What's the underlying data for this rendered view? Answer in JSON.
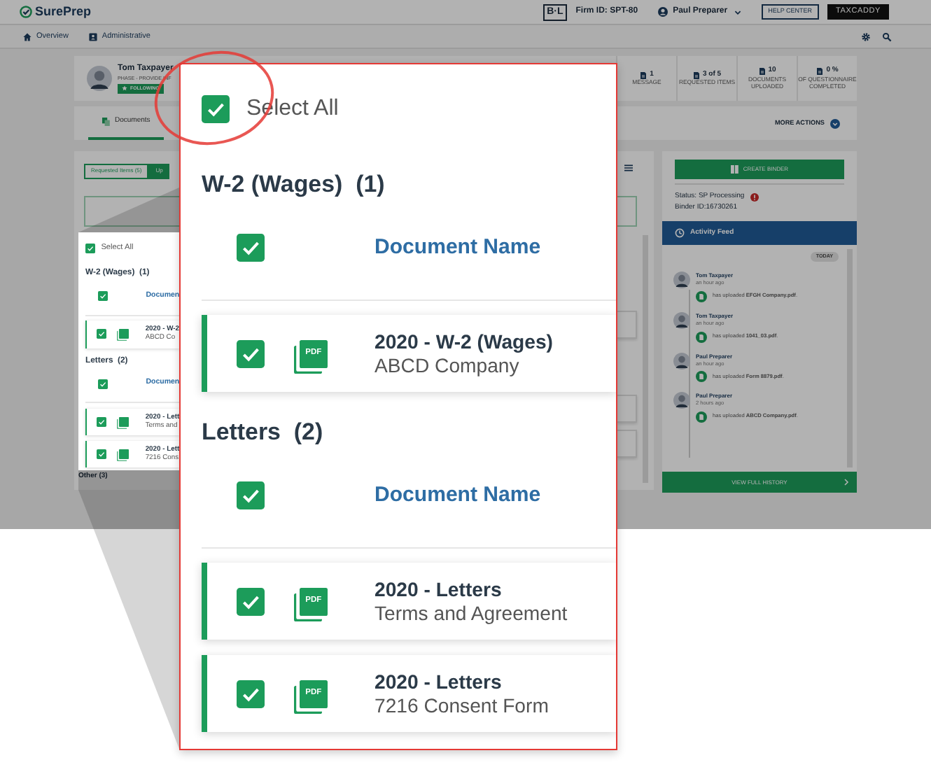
{
  "header": {
    "logo": "SurePrep",
    "firm_badge": "B·L",
    "firm_id": "Firm ID: SPT-80",
    "user": "Paul Preparer",
    "help": "HELP CENTER",
    "taxcaddy": "TAXCADDY"
  },
  "nav": [
    {
      "label": "Overview",
      "kind": "home"
    },
    {
      "label": "Administrative",
      "kind": "admin"
    }
  ],
  "client": {
    "name": "Tom Taxpayer",
    "phase": "PHASE - PROVIDE INF",
    "following": "FOLLOWING"
  },
  "stats": [
    {
      "value": "1",
      "label": "MESSAGE"
    },
    {
      "value": "3 of 5",
      "label": "REQUESTED ITEMS"
    },
    {
      "value": "10",
      "label": "DOCUMENTS UPLOADED"
    },
    {
      "value": "0 %",
      "label": "OF QUESTIONNAIRE COMPLETED"
    }
  ],
  "tabs": [
    {
      "label": "Documents",
      "selected": true
    }
  ],
  "more_actions": "MORE ACTIONS",
  "filters": [
    {
      "label": "Requested Items (5)",
      "selected": false
    },
    {
      "label": "Up",
      "selected": true
    }
  ],
  "other_group": "Other (3)",
  "binder": {
    "button": "CREATE BINDER",
    "status": "Status: SP Processing",
    "binder_id": "Binder ID:16730261"
  },
  "activity": {
    "title": "Activity Feed",
    "day": "TODAY",
    "footer": "VIEW FULL HISTORY",
    "entries": [
      {
        "name": "Tom Taxpayer",
        "time": "an hour ago",
        "text": "has uploaded **EFGH Company.pdf**."
      },
      {
        "name": "Tom Taxpayer",
        "time": "an hour ago",
        "text": "has uploaded **1041_03.pdf**."
      },
      {
        "name": "Paul Preparer",
        "time": "an hour ago",
        "text": "has uploaded **Form 8879.pdf**."
      },
      {
        "name": "Paul Preparer",
        "time": "2 hours ago",
        "text": "has uploaded **ABCD Company.pdf**."
      }
    ]
  },
  "mini_list": {
    "select_all": {
      "label": "Select All",
      "checked": true
    },
    "groups": [
      {
        "title": "W-2 (Wages)",
        "count": "(1)",
        "header_checked": true,
        "column": "Documen",
        "docs": [
          {
            "title": "2020 - W-2",
            "subtitle": "ABCD Co",
            "checked": true
          }
        ]
      },
      {
        "title": "Letters",
        "count": "(2)",
        "header_checked": true,
        "column": "Documen",
        "docs": [
          {
            "title": "2020 - Lett",
            "subtitle": "Terms and",
            "checked": true
          },
          {
            "title": "2020 - Lett",
            "subtitle": "7216 Cons",
            "checked": true
          }
        ]
      }
    ]
  },
  "callout": {
    "select_all": {
      "label": "Select All",
      "checked": true
    },
    "groups": [
      {
        "title": "W-2 (Wages)",
        "count": "(1)",
        "header_checked": true,
        "column": "Document Name",
        "docs": [
          {
            "title": "2020 - W-2 (Wages)",
            "subtitle": "ABCD Company",
            "file_type": "PDF",
            "checked": true
          }
        ]
      },
      {
        "title": "Letters",
        "count": "(2)",
        "header_checked": true,
        "column": "Document Name",
        "docs": [
          {
            "title": "2020 - Letters",
            "subtitle": "Terms and Agreement",
            "file_type": "PDF",
            "checked": true
          },
          {
            "title": "2020 - Letters",
            "subtitle": "7216 Consent Form",
            "file_type": "PDF",
            "checked": true
          }
        ]
      }
    ]
  }
}
